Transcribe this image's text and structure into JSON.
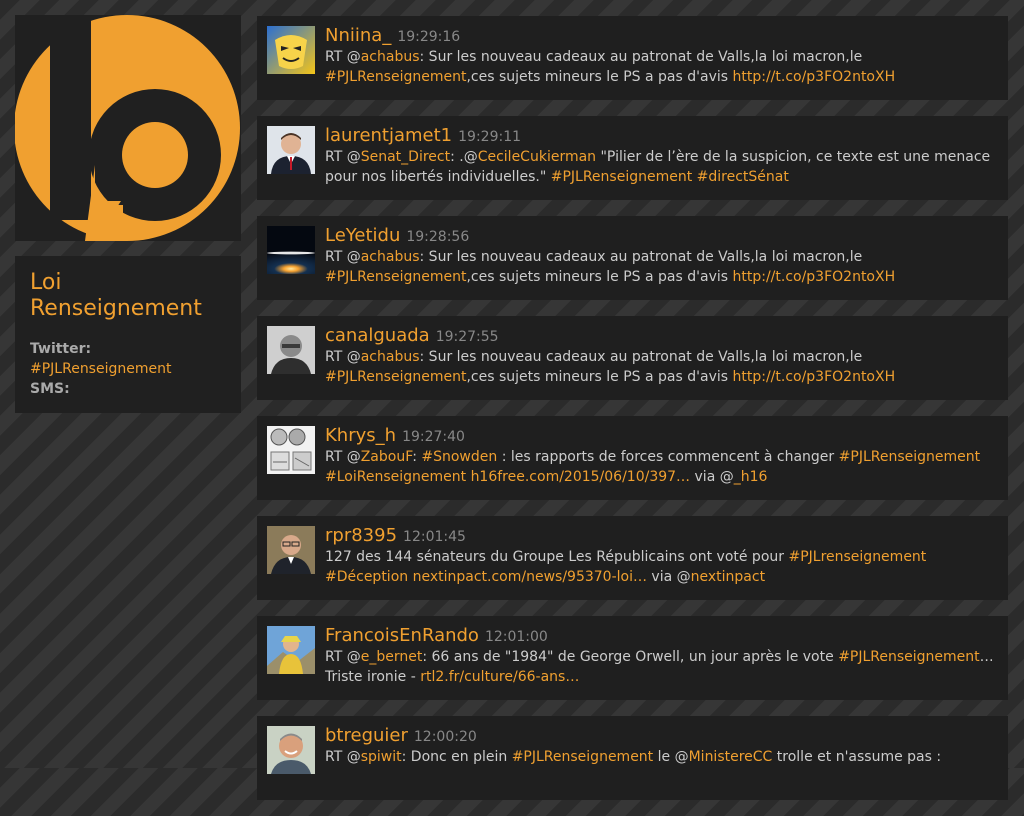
{
  "colors": {
    "accent": "#f0a030",
    "panel": "#202020",
    "text": "#cccccc",
    "muted": "#888888"
  },
  "logo": {
    "icon": "speech-bubble-b-logo-icon"
  },
  "sidebar": {
    "title": "Loi Renseignement",
    "twitter_label": "Twitter:",
    "twitter_value": "#PJLRenseignement",
    "sms_label": "SMS:"
  },
  "tweets": [
    {
      "user": "Nniina_",
      "time": "19:29:16",
      "avatar": "mask-avatar",
      "parts": [
        {
          "t": "RT @"
        },
        {
          "t": "achabus",
          "o": true
        },
        {
          "t": ": Sur les nouveau cadeaux au patronat de Valls,la loi macron,le "
        },
        {
          "t": "#PJLRenseignement",
          "o": true
        },
        {
          "t": ",ces sujets mineurs le PS a pas d'avis "
        },
        {
          "t": "http://t.co/p3FO2ntoXH",
          "o": true
        }
      ]
    },
    {
      "user": "laurentjamet1",
      "time": "19:29:11",
      "avatar": "man-suit-avatar",
      "parts": [
        {
          "t": "RT @"
        },
        {
          "t": "Senat_Direct",
          "o": true
        },
        {
          "t": ": .@"
        },
        {
          "t": "CecileCukierman",
          "o": true
        },
        {
          "t": " \"Pilier de l’ère de la suspicion, ce texte est une menace pour nos libertés individuelles.\" "
        },
        {
          "t": "#PJLRenseignement",
          "o": true
        },
        {
          "t": " "
        },
        {
          "t": "#directSénat",
          "o": true
        }
      ]
    },
    {
      "user": "LeYetidu",
      "time": "19:28:56",
      "avatar": "planet-sunrise-avatar",
      "parts": [
        {
          "t": "RT @"
        },
        {
          "t": "achabus",
          "o": true
        },
        {
          "t": ": Sur les nouveau cadeaux au patronat de Valls,la loi macron,le "
        },
        {
          "t": "#PJLRenseignement",
          "o": true
        },
        {
          "t": ",ces sujets mineurs le PS a pas d'avis "
        },
        {
          "t": "http://t.co/p3FO2ntoXH",
          "o": true
        }
      ]
    },
    {
      "user": "canalguada",
      "time": "19:27:55",
      "avatar": "man-bw-avatar",
      "parts": [
        {
          "t": "RT @"
        },
        {
          "t": "achabus",
          "o": true
        },
        {
          "t": ": Sur les nouveau cadeaux au patronat de Valls,la loi macron,le "
        },
        {
          "t": "#PJLRenseignement",
          "o": true
        },
        {
          "t": ",ces sujets mineurs le PS a pas d'avis "
        },
        {
          "t": "http://t.co/p3FO2ntoXH",
          "o": true
        }
      ]
    },
    {
      "user": "Khrys_h",
      "time": "19:27:40",
      "avatar": "coins-sketch-avatar",
      "parts": [
        {
          "t": "RT @"
        },
        {
          "t": "ZabouF",
          "o": true
        },
        {
          "t": ": "
        },
        {
          "t": "#Snowden",
          "o": true
        },
        {
          "t": " : les rapports de forces commencent à changer "
        },
        {
          "t": "#PJLRenseignement",
          "o": true
        },
        {
          "t": " "
        },
        {
          "t": "#LoiRenseignement",
          "o": true
        },
        {
          "t": " "
        },
        {
          "t": "h16free.com/2015/06/10/397…",
          "o": true
        },
        {
          "t": " via @"
        },
        {
          "t": "_h16",
          "o": true
        }
      ]
    },
    {
      "user": "rpr8395",
      "time": "12:01:45",
      "avatar": "man-glasses-avatar",
      "parts": [
        {
          "t": "127 des 144 sénateurs du Groupe Les Républicains ont voté pour "
        },
        {
          "t": "#PJLrenseignement",
          "o": true
        },
        {
          "t": " "
        },
        {
          "t": "#Déception",
          "o": true
        },
        {
          "t": " "
        },
        {
          "t": "nextinpact.com/news/95370-loi…",
          "o": true
        },
        {
          "t": " via @"
        },
        {
          "t": "nextinpact",
          "o": true
        }
      ]
    },
    {
      "user": "FrancoisEnRando",
      "time": "12:01:00",
      "avatar": "hiker-avatar",
      "parts": [
        {
          "t": "RT @"
        },
        {
          "t": "e_bernet",
          "o": true
        },
        {
          "t": ": 66 ans de \"1984\" de George Orwell, un jour après le vote "
        },
        {
          "t": "#PJLRenseignement",
          "o": true
        },
        {
          "t": "… Triste ironie - "
        },
        {
          "t": "rtl2.fr/culture/66-ans…",
          "o": true
        }
      ]
    },
    {
      "user": "btreguier",
      "time": "12:00:20",
      "avatar": "man-smile-avatar",
      "parts": [
        {
          "t": "RT @"
        },
        {
          "t": "spiwit",
          "o": true
        },
        {
          "t": ": Donc en plein "
        },
        {
          "t": "#PJLRenseignement",
          "o": true
        },
        {
          "t": " le @"
        },
        {
          "t": "MinistereCC",
          "o": true
        },
        {
          "t": " trolle et n'assume pas :"
        }
      ]
    }
  ]
}
